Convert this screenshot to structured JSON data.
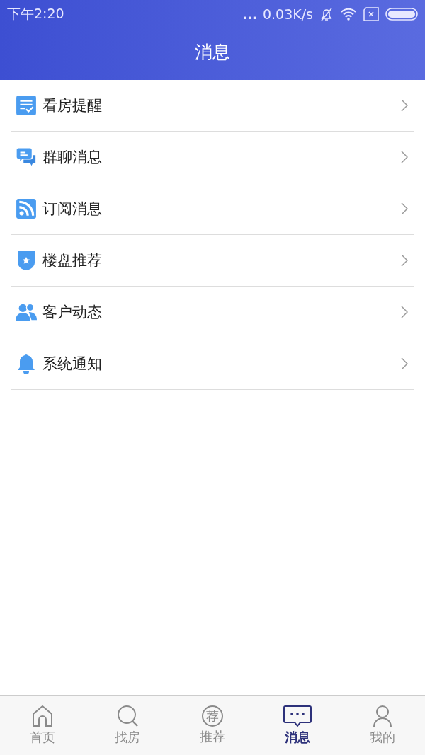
{
  "status_bar": {
    "time": "下午2:20",
    "dots": "...",
    "speed": "0.03K/s"
  },
  "header": {
    "title": "消息"
  },
  "menu": [
    {
      "kind": "checklist",
      "label": "看房提醒"
    },
    {
      "kind": "chat",
      "label": "群聊消息"
    },
    {
      "kind": "rss",
      "label": "订阅消息"
    },
    {
      "kind": "badge",
      "label": "楼盘推荐"
    },
    {
      "kind": "people",
      "label": "客户动态"
    },
    {
      "kind": "bell",
      "label": "系统通知"
    }
  ],
  "tabs": [
    {
      "kind": "home",
      "label": "首页",
      "selected": false
    },
    {
      "kind": "search",
      "label": "找房",
      "selected": false
    },
    {
      "kind": "glyph",
      "glyph": "荐",
      "label": "推荐",
      "selected": false
    },
    {
      "kind": "message",
      "label": "消息",
      "selected": true
    },
    {
      "kind": "person",
      "label": "我的",
      "selected": false
    }
  ]
}
